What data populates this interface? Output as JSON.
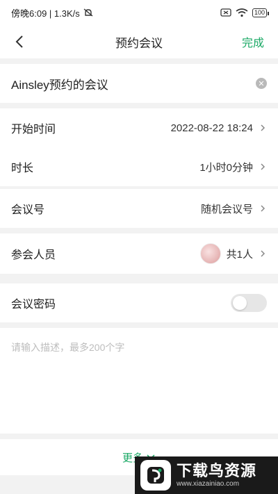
{
  "status_bar": {
    "time_text": "傍晚6:09 | 1.3K/s",
    "battery": "100"
  },
  "header": {
    "title": "预约会议",
    "done_label": "完成"
  },
  "meeting_name": "Ainsley预约的会议",
  "rows": {
    "start_time": {
      "label": "开始时间",
      "value": "2022-08-22 18:24"
    },
    "duration": {
      "label": "时长",
      "value": "1小时0分钟"
    },
    "meeting_id": {
      "label": "会议号",
      "value": "随机会议号"
    },
    "participants": {
      "label": "参会人员",
      "value": "共1人"
    },
    "password": {
      "label": "会议密码",
      "enabled": false
    }
  },
  "description": {
    "placeholder": "请输入描述，最多200个字"
  },
  "more": {
    "label": "更多"
  },
  "watermark": {
    "title": "下载鸟资源",
    "url": "www.xiazainiao.com"
  },
  "colors": {
    "accent": "#19a864",
    "background": "#f2f2f2"
  }
}
